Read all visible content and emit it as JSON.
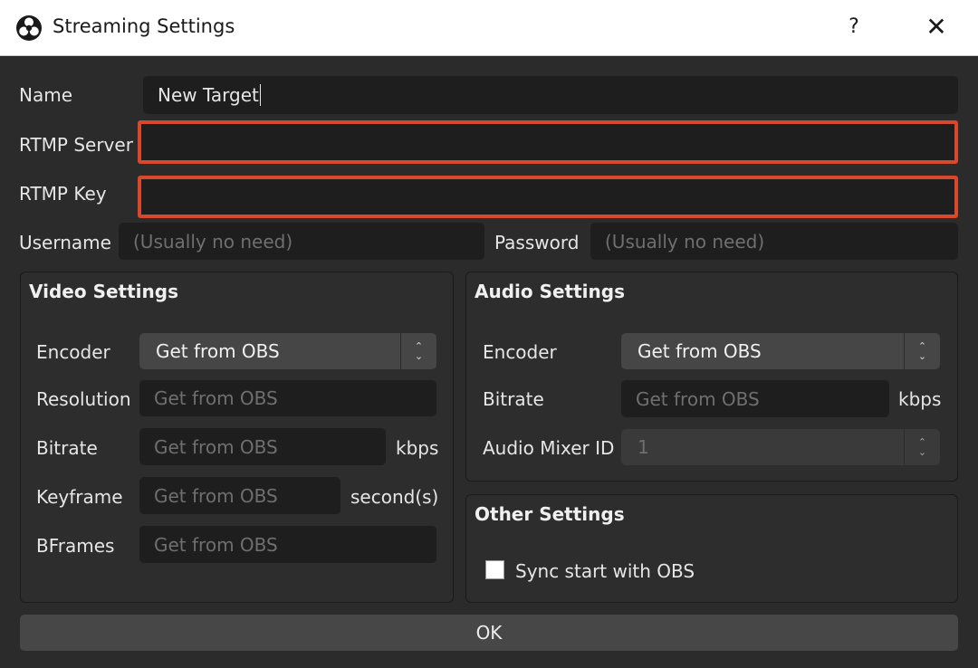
{
  "window": {
    "title": "Streaming Settings",
    "help_label": "?",
    "close_label": "✕",
    "icon": "obs-logo-icon"
  },
  "target": {
    "name_label": "Name",
    "name_value": "New Target",
    "rtmp_server_label": "RTMP Server",
    "rtmp_server_value": "",
    "rtmp_key_label": "RTMP Key",
    "rtmp_key_value": "",
    "username_label": "Username",
    "username_placeholder": "(Usually no need)",
    "password_label": "Password",
    "password_placeholder": "(Usually no need)"
  },
  "video": {
    "title": "Video Settings",
    "encoder_label": "Encoder",
    "encoder_value": "Get from OBS",
    "resolution_label": "Resolution",
    "resolution_placeholder": "Get from OBS",
    "bitrate_label": "Bitrate",
    "bitrate_placeholder": "Get from OBS",
    "bitrate_unit": "kbps",
    "keyframe_label": "Keyframe",
    "keyframe_placeholder": "Get from OBS",
    "keyframe_unit": "second(s)",
    "bframes_label": "BFrames",
    "bframes_placeholder": "Get from OBS"
  },
  "audio": {
    "title": "Audio Settings",
    "encoder_label": "Encoder",
    "encoder_value": "Get from OBS",
    "bitrate_label": "Bitrate",
    "bitrate_placeholder": "Get from OBS",
    "bitrate_unit": "kbps",
    "mixer_label": "Audio Mixer ID",
    "mixer_value": "1"
  },
  "other": {
    "title": "Other Settings",
    "sync_label": "Sync start with OBS",
    "sync_checked": false
  },
  "ok_label": "OK",
  "colors": {
    "error_border": "#d8492b",
    "background": "#2b2b2b",
    "field": "#1e1e1e"
  }
}
